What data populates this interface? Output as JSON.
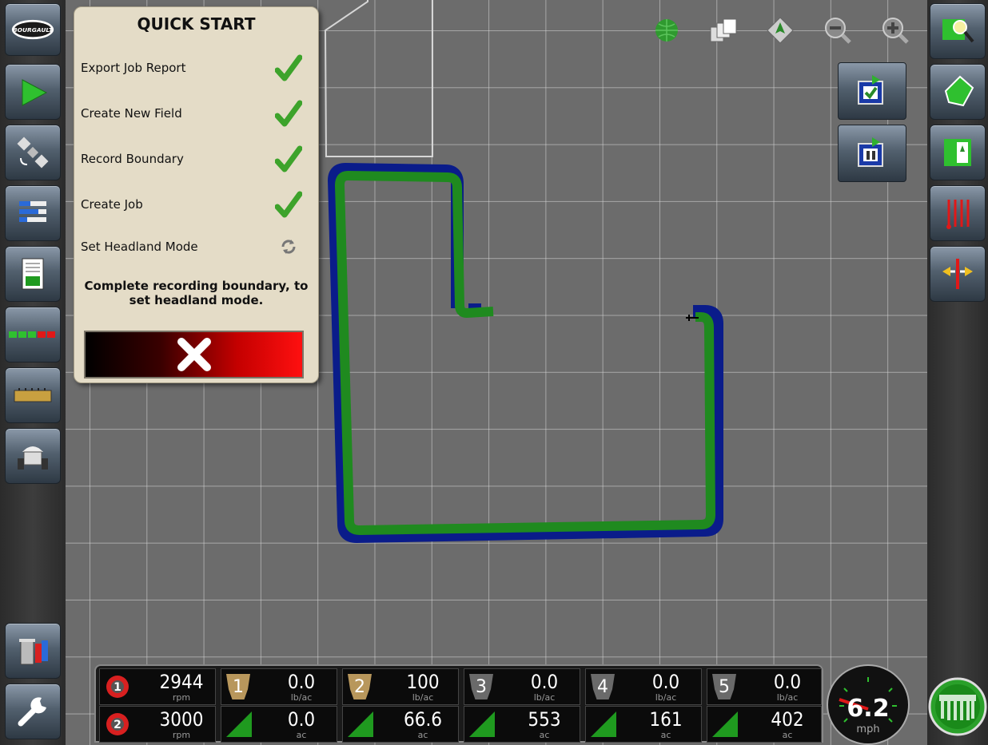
{
  "quick_start": {
    "title": "QUICK START",
    "items": [
      {
        "label": "Export Job Report",
        "status": "check"
      },
      {
        "label": "Create New Field",
        "status": "check"
      },
      {
        "label": "Record Boundary",
        "status": "check"
      },
      {
        "label": "Create Job",
        "status": "check"
      },
      {
        "label": "Set Headland Mode",
        "status": "pending"
      }
    ],
    "message": "Complete recording boundary, to set headland mode."
  },
  "brand": {
    "logo_text": "BOURGAULT"
  },
  "left_sidebar": {
    "icons": [
      "bourgault-logo-icon",
      "guidance-arrow-icon",
      "gps-satellite-icon",
      "layers-list-icon",
      "report-icon",
      "section-status-icon",
      "product-bins-icon",
      "implement-icon",
      "data-transfer-icon",
      "settings-wrench-icon"
    ]
  },
  "right_sidebar": {
    "icons": [
      "field-map-search-icon",
      "field-boundary-icon",
      "headland-icon",
      "guidance-lines-icon",
      "shift-line-icon"
    ]
  },
  "map_toolbar": {
    "icons": [
      "gps-status-icon",
      "layers-icon",
      "north-up-icon",
      "zoom-out-icon",
      "zoom-in-icon"
    ]
  },
  "bottom_bar": {
    "fans": [
      {
        "number": "1",
        "value": "2944",
        "unit": "rpm"
      },
      {
        "number": "2",
        "value": "3000",
        "unit": "rpm"
      }
    ],
    "products": [
      {
        "number": "1",
        "rate": "0.0",
        "rate_unit": "lb/ac",
        "area": "0.0",
        "area_unit": "ac",
        "color": "#b8975c"
      },
      {
        "number": "2",
        "rate": "100",
        "rate_unit": "lb/ac",
        "area": "66.6",
        "area_unit": "ac",
        "color": "#b8975c"
      },
      {
        "number": "3",
        "rate": "0.0",
        "rate_unit": "lb/ac",
        "area": "553",
        "area_unit": "ac",
        "color": "#6a6a6a"
      },
      {
        "number": "4",
        "rate": "0.0",
        "rate_unit": "lb/ac",
        "area": "161",
        "area_unit": "ac",
        "color": "#6a6a6a"
      },
      {
        "number": "5",
        "rate": "0.0",
        "rate_unit": "lb/ac",
        "area": "402",
        "area_unit": "ac",
        "color": "#6a6a6a"
      }
    ],
    "speed": {
      "value": "6.2",
      "unit": "mph"
    }
  },
  "colors": {
    "coverage": "#1f8a1f",
    "boundary": "#0a1c8a",
    "panel": "#e4dcc7",
    "check": "#3da32b"
  }
}
